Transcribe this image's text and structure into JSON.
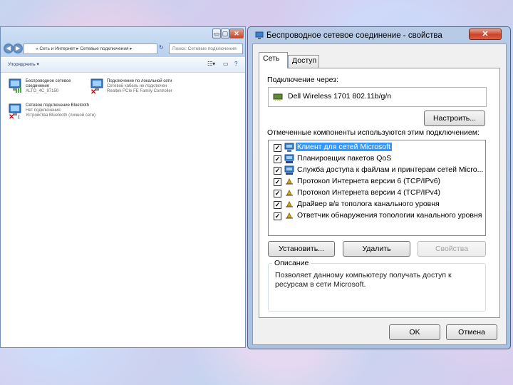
{
  "explorer": {
    "caption_buttons": [
      "▭",
      "▢",
      "✕"
    ],
    "address": "« Сеть и Интернет ▸ Сетевые подключения ▸",
    "search_placeholder": "Поиск: Сетевые подключения",
    "command": "Упорядочить ▾",
    "connections": [
      {
        "name": "Беспроводное сетевое",
        "name2": "соединение",
        "status": "ALTO_4C_97150",
        "icon": "wireless-network-icon"
      },
      {
        "name": "Подключение по локальной сети",
        "name2": "Сетевой кабель не подключен",
        "status": "Realtek PCIe FE Family Controller",
        "icon": "lan-network-icon"
      },
      {
        "name": "Сетевое подключение Bluetooth",
        "name2": "Нет подключения",
        "status": "Устройства Bluetooth (личной сети)",
        "icon": "bluetooth-network-icon"
      }
    ]
  },
  "dialog": {
    "title": "Беспроводное сетевое соединение - свойства",
    "close_label": "✕",
    "tabs": [
      "Сеть",
      "Доступ"
    ],
    "connect_using_label": "Подключение через:",
    "adapter_name": "Dell Wireless 1701 802.11b/g/n",
    "configure_button": "Настроить...",
    "components_label": "Отмеченные компоненты используются этим подключением:",
    "components": [
      {
        "label": "Клиент для сетей Microsoft",
        "checked": true,
        "selected": true,
        "icon": "client-network-icon"
      },
      {
        "label": "Планировщик пакетов QoS",
        "checked": true,
        "selected": false,
        "icon": "qos-scheduler-icon"
      },
      {
        "label": "Служба доступа к файлам и принтерам сетей Micro...",
        "checked": true,
        "selected": false,
        "icon": "file-printer-sharing-icon"
      },
      {
        "label": "Протокол Интернета версии 6 (TCP/IPv6)",
        "checked": true,
        "selected": false,
        "icon": "protocol-icon"
      },
      {
        "label": "Протокол Интернета версии 4 (TCP/IPv4)",
        "checked": true,
        "selected": false,
        "icon": "protocol-icon"
      },
      {
        "label": "Драйвер в/в тополога канального уровня",
        "checked": true,
        "selected": false,
        "icon": "protocol-icon"
      },
      {
        "label": "Ответчик обнаружения топологии канального уровня",
        "checked": true,
        "selected": false,
        "icon": "protocol-icon"
      }
    ],
    "install_button": "Установить...",
    "uninstall_button": "Удалить",
    "properties_button": "Свойства",
    "description_legend": "Описание",
    "description_text": "Позволяет данному компьютеру получать доступ к ресурсам в сети Microsoft.",
    "ok_button": "OK",
    "cancel_button": "Отмена"
  },
  "colors": {
    "selection": "#3399ff",
    "close_button": "#c8432a",
    "frame": "#b7cbe6"
  }
}
